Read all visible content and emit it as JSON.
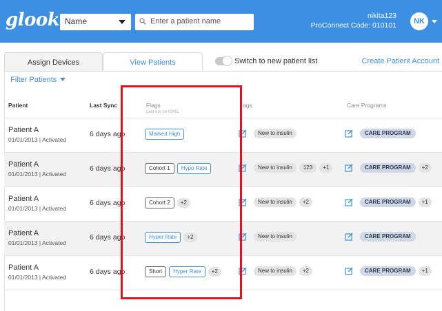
{
  "header": {
    "logo": "glooko",
    "name_select": "Name",
    "search_placeholder": "Enter a patient name",
    "username": "nikita123",
    "proconnect": "ProConnect Code: 010101",
    "avatar_initials": "NK"
  },
  "tabs": {
    "assign": "Assign Devices",
    "view": "View Patients",
    "switch_label": "Switch to new patient list",
    "create_link": "Create Patient Account"
  },
  "filter_label": "Filter Patients",
  "columns": {
    "patient": "Patient",
    "last_sync": "Last Sync",
    "flags": "Flags",
    "flags_sub": "Last run on 03/05",
    "tags": "ags",
    "care_programs": "Care Programs"
  },
  "rows": [
    {
      "name": "Patient A",
      "date": "01/01/2013 | Activated",
      "sync": "6 days ago",
      "flags": [
        {
          "label": "Marked High",
          "style": "blue"
        }
      ],
      "flags_more": "",
      "tags": [
        "New to insulin"
      ],
      "tags_more": "",
      "care": "CARE PROGRAM",
      "care_more": ""
    },
    {
      "name": "Patient A",
      "date": "01/01/2013 | Activated",
      "sync": "6 days ago",
      "flags": [
        {
          "label": "Cohort 1",
          "style": "dark"
        },
        {
          "label": "Hypo Rate",
          "style": "blue"
        }
      ],
      "flags_more": "",
      "tags": [
        "New to insulin",
        "123"
      ],
      "tags_more": "+1",
      "care": "CARE PROGRAM",
      "care_more": "+2"
    },
    {
      "name": "Patient A",
      "date": "01/01/2013 | Activated",
      "sync": "6 days ago",
      "flags": [
        {
          "label": "Cohort 2",
          "style": "dark"
        }
      ],
      "flags_more": "+2",
      "tags": [
        "New to insulin"
      ],
      "tags_more": "+2",
      "care": "CARE PROGRAM",
      "care_more": "+1"
    },
    {
      "name": "Patient A",
      "date": "01/01/2013 | Activated",
      "sync": "6 days ago",
      "flags": [
        {
          "label": "Hyper Rate",
          "style": "blue"
        }
      ],
      "flags_more": "+2",
      "tags": [
        "New to insulin"
      ],
      "tags_more": "",
      "care": "CARE PROGRAM",
      "care_more": ""
    },
    {
      "name": "Patient A",
      "date": "01/01/2013 | Activated",
      "sync": "6 days ago",
      "flags": [
        {
          "label": "Short",
          "style": "dark"
        },
        {
          "label": "Hyper Rate",
          "style": "blue"
        }
      ],
      "flags_more": "+2",
      "tags": [
        "New to insulin"
      ],
      "tags_more": "+2",
      "care": "CARE PROGRAM",
      "care_more": "+1"
    }
  ],
  "colors": {
    "brand": "#3d8fe3",
    "highlight": "#e0141f",
    "care_chip": "#cfd8e4"
  },
  "icons": {
    "search": "search-icon",
    "edit": "edit-icon",
    "caret": "chevron-down-icon"
  }
}
